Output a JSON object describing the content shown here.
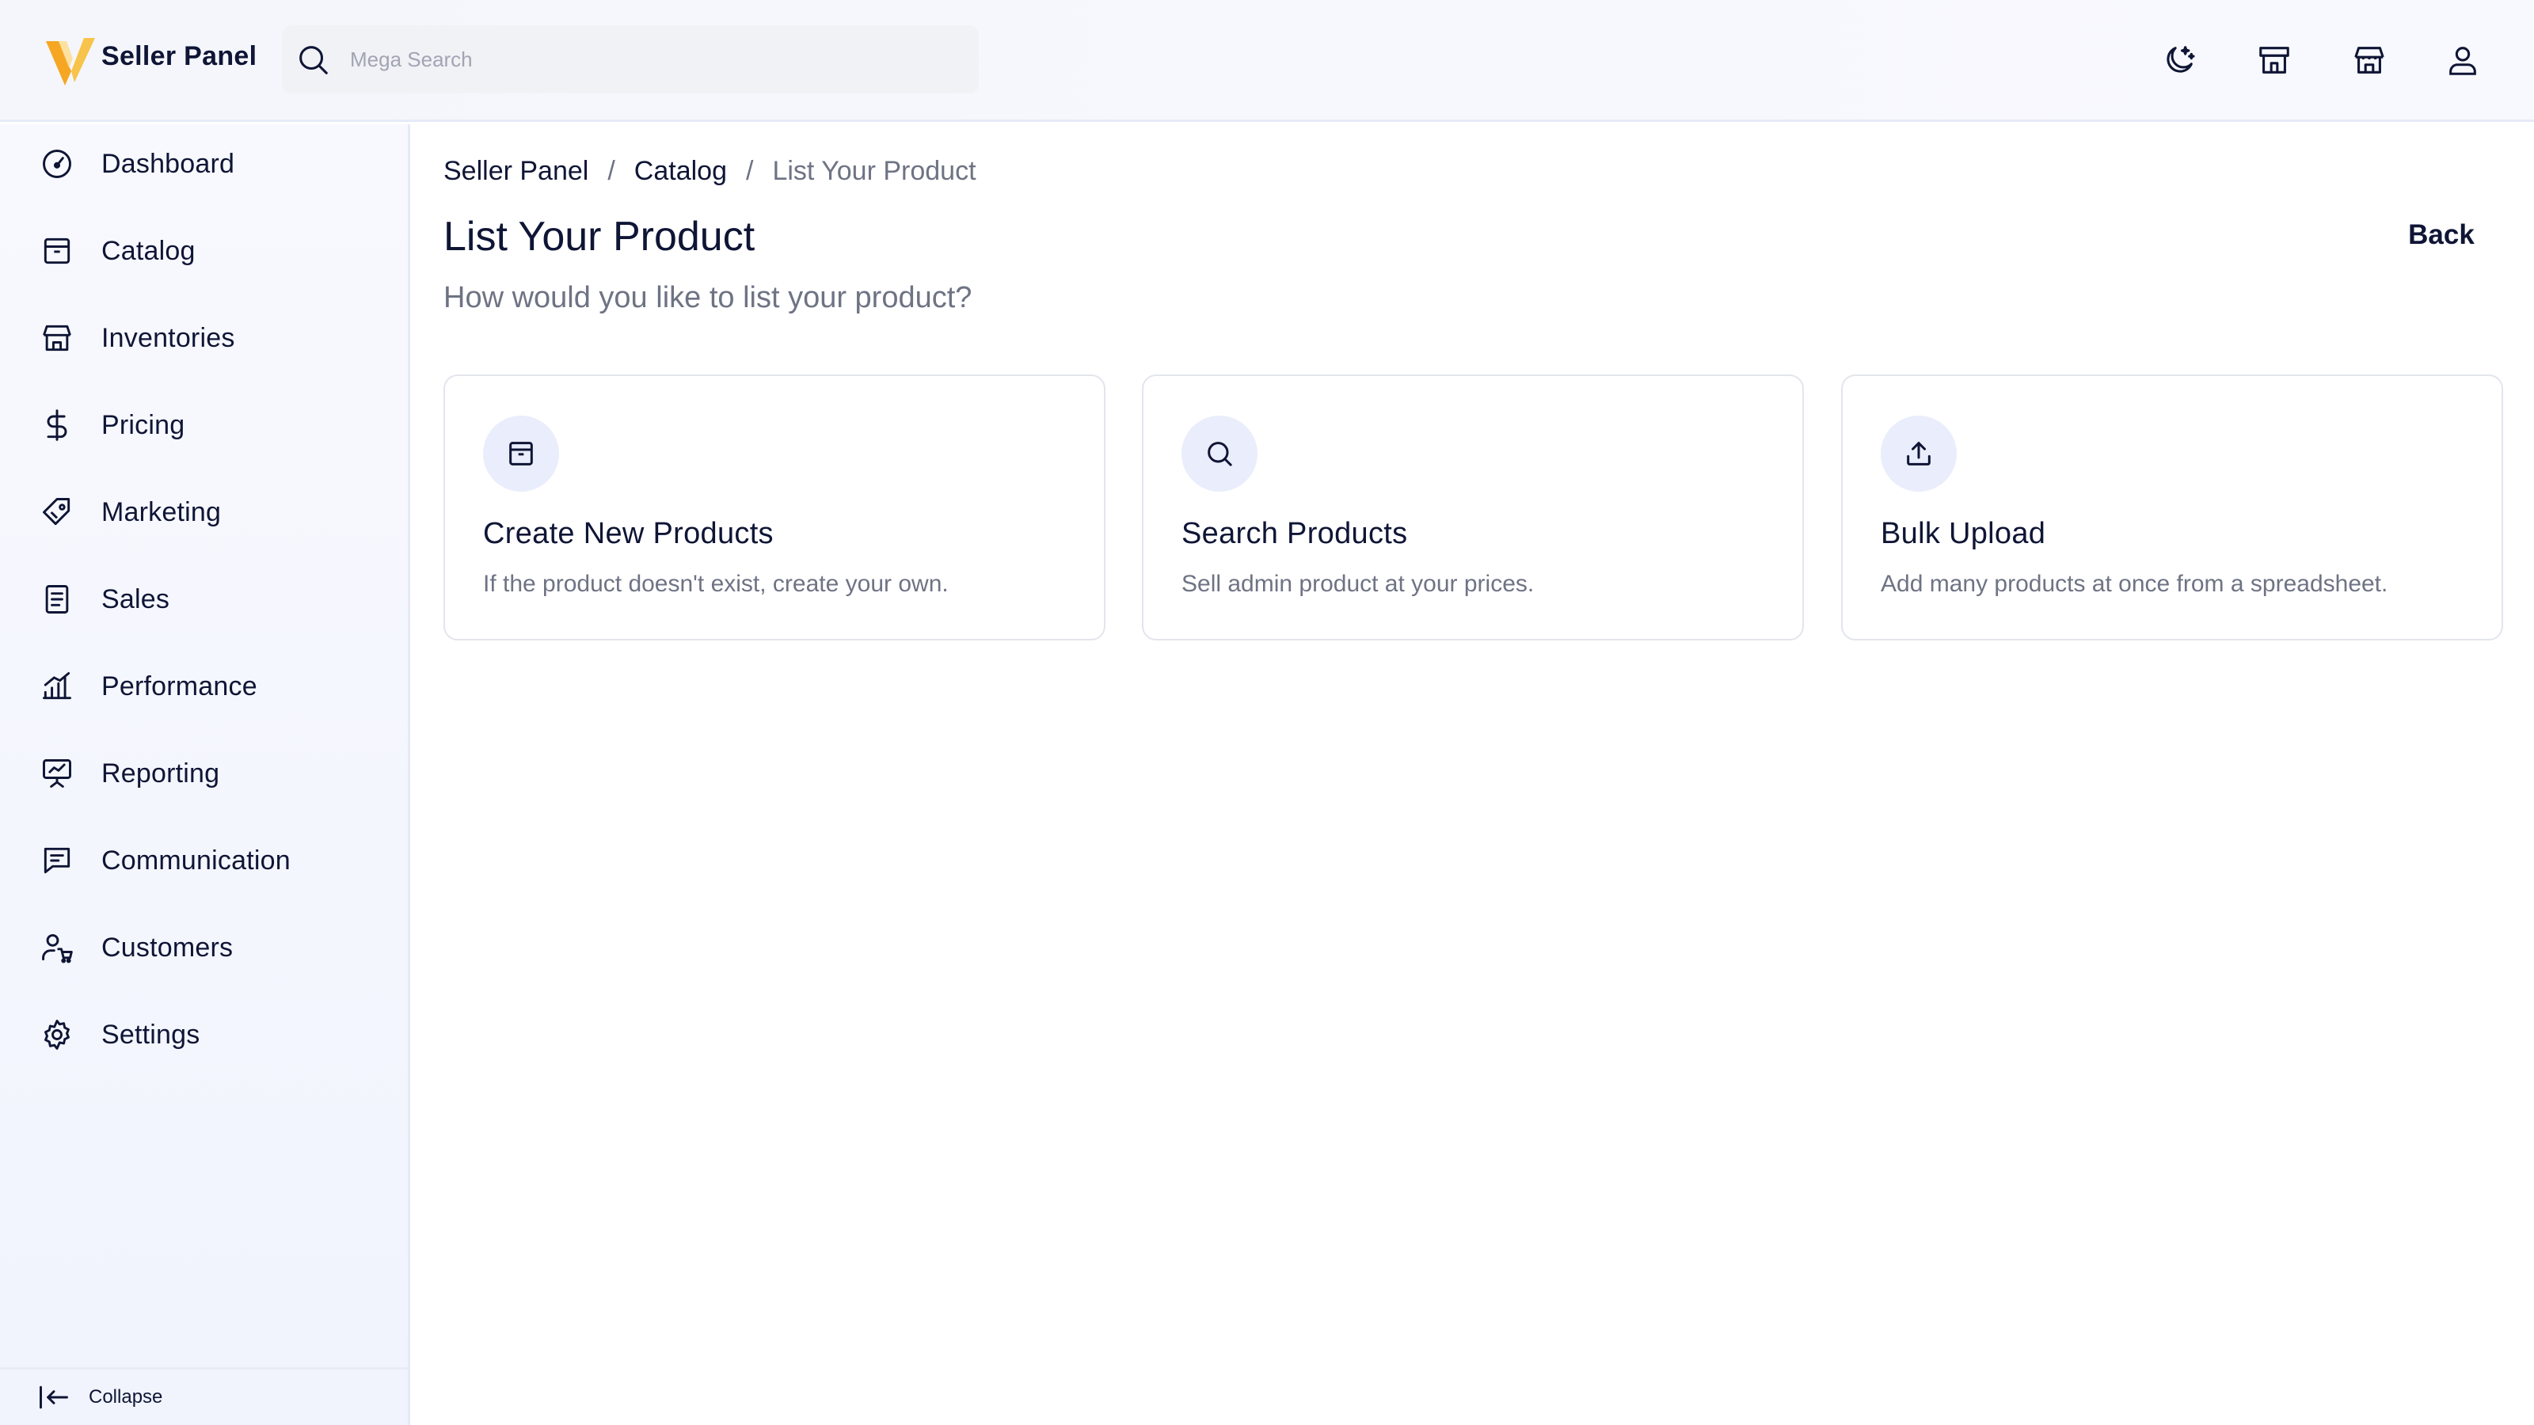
{
  "header": {
    "brand": "Seller Panel",
    "search_placeholder": "Mega Search",
    "accent_color": "#f5a623",
    "icons": [
      "dark-mode-icon",
      "store-icon",
      "warehouse-icon",
      "user-icon"
    ]
  },
  "sidebar": {
    "items": [
      {
        "label": "Dashboard",
        "icon": "dashboard-icon"
      },
      {
        "label": "Catalog",
        "icon": "catalog-icon"
      },
      {
        "label": "Inventories",
        "icon": "inventories-icon"
      },
      {
        "label": "Pricing",
        "icon": "dollar-icon"
      },
      {
        "label": "Marketing",
        "icon": "tag-icon"
      },
      {
        "label": "Sales",
        "icon": "receipt-icon"
      },
      {
        "label": "Performance",
        "icon": "bar-chart-icon"
      },
      {
        "label": "Reporting",
        "icon": "presentation-icon"
      },
      {
        "label": "Communication",
        "icon": "message-icon"
      },
      {
        "label": "Customers",
        "icon": "customer-icon"
      },
      {
        "label": "Settings",
        "icon": "gear-icon"
      }
    ],
    "collapse_label": "Collapse"
  },
  "main": {
    "breadcrumb": [
      "Seller Panel",
      "Catalog",
      "List Your Product"
    ],
    "breadcrumb_separator": "/",
    "title": "List Your Product",
    "subtitle": "How would you like to list your product?",
    "back_label": "Back",
    "cards": [
      {
        "title": "Create New Products",
        "description": "If the product doesn't exist, create your own.",
        "icon": "box-icon"
      },
      {
        "title": "Search Products",
        "description": "Sell admin product at your prices.",
        "icon": "search-icon"
      },
      {
        "title": "Bulk Upload",
        "description": "Add many products at once from a spreadsheet.",
        "icon": "upload-icon"
      }
    ]
  }
}
